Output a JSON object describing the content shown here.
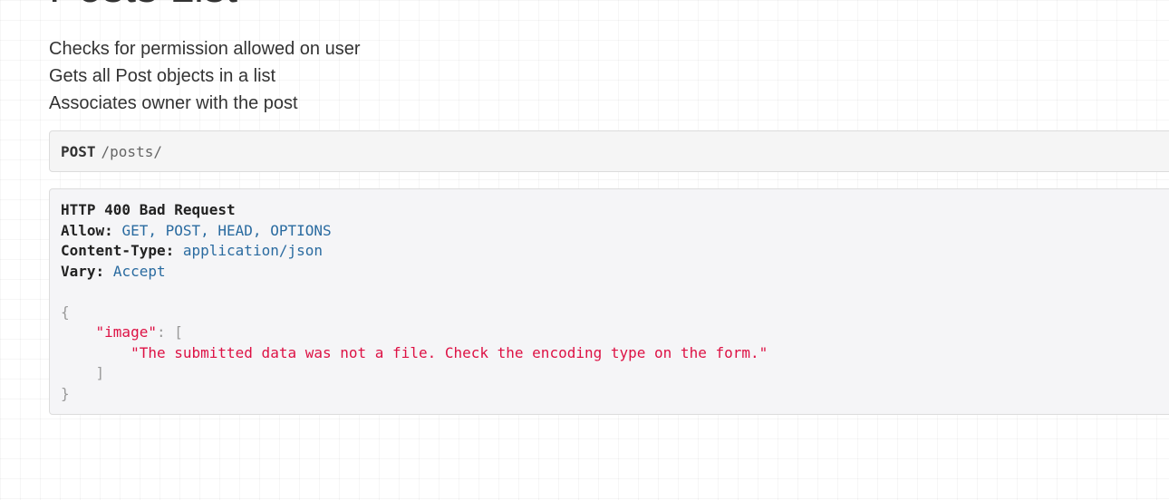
{
  "page": {
    "title": "Posts List",
    "description": [
      "Checks for permission allowed on user",
      "Gets all Post objects in a list",
      "Associates owner with the post"
    ]
  },
  "request": {
    "method": "POST",
    "path": "/posts/"
  },
  "response": {
    "status_line": "HTTP 400 Bad Request",
    "headers": [
      {
        "key": "Allow:",
        "value": "GET, POST, HEAD, OPTIONS"
      },
      {
        "key": "Content-Type:",
        "value": "application/json"
      },
      {
        "key": "Vary:",
        "value": "Accept"
      }
    ],
    "body": {
      "open_brace": "{",
      "key": "\"image\"",
      "colon_bracket": ": [",
      "message": "\"The submitted data was not a file. Check the encoding type on the form.\"",
      "close_bracket": "]",
      "close_brace": "}"
    }
  },
  "colors": {
    "header_value": "#2a6ba0",
    "json_string": "#dd1144",
    "box_background": "#f5f5f7"
  }
}
